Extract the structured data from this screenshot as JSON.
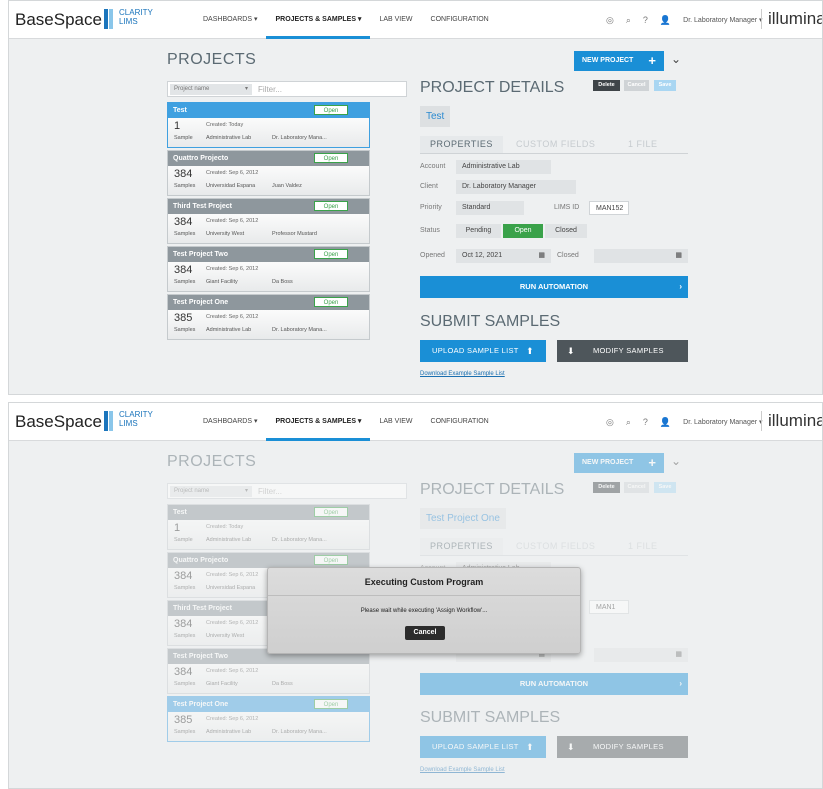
{
  "app": {
    "brand": "BaseSpace",
    "sublogo_line1": "CLARITY",
    "sublogo_line2": "LIMS",
    "vendor": "illumina",
    "accent": "#1a8fd6"
  },
  "nav": {
    "items": [
      "DASHBOARDS ▾",
      "PROJECTS & SAMPLES ▾",
      "LAB VIEW",
      "CONFIGURATION"
    ],
    "active_index": 1,
    "icons": [
      "help-circle-icon",
      "search-icon",
      "question-icon",
      "user-icon"
    ],
    "user": "Dr. Laboratory Manager ▾"
  },
  "projects": {
    "title": "PROJECTS",
    "filter_select": "Project name",
    "filter_placeholder": "Filter..."
  },
  "details": {
    "title": "PROJECT DETAILS",
    "new_project": "NEW PROJECT",
    "delete": "Delete",
    "cancel": "Cancel",
    "save": "Save",
    "tabs": [
      "PROPERTIES",
      "CUSTOM FIELDS",
      "1 FILE"
    ],
    "labels": {
      "account": "Account",
      "client": "Client",
      "priority": "Priority",
      "lims_id": "LIMS ID",
      "status": "Status",
      "opened": "Opened",
      "closed": "Closed"
    },
    "status_options": [
      "Pending",
      "Open",
      "Closed"
    ],
    "run_automation": "RUN AUTOMATION",
    "submit_title": "SUBMIT SAMPLES",
    "upload": "UPLOAD SAMPLE LIST",
    "modify": "MODIFY SAMPLES",
    "download_link": "Download Example Sample List"
  },
  "screen1": {
    "project_name": "Test",
    "account": "Administrative Lab",
    "client": "Dr. Laboratory Manager",
    "priority": "Standard",
    "lims_id": "MAN152",
    "opened": "Oct 12, 2021",
    "closed": "",
    "projects": [
      {
        "name": "Test",
        "badge": "Open",
        "count": "1",
        "unit": "Sample",
        "created": "Created: Today",
        "place": "Administrative Lab",
        "owner": "Dr. Laboratory Mana..."
      },
      {
        "name": "Quattro Projecto",
        "badge": "Open",
        "count": "384",
        "unit": "Samples",
        "created": "Created: Sep 6, 2012",
        "place": "Universidad Espana",
        "owner": "Juan Valdez"
      },
      {
        "name": "Third Test Project",
        "badge": "Open",
        "count": "384",
        "unit": "Samples",
        "created": "Created: Sep 6, 2012",
        "place": "University West",
        "owner": "Professor Mustard"
      },
      {
        "name": "Test Project Two",
        "badge": "Open",
        "count": "384",
        "unit": "Samples",
        "created": "Created: Sep 6, 2012",
        "place": "Giant Facility",
        "owner": "Da Boss"
      },
      {
        "name": "Test Project One",
        "badge": "Open",
        "count": "385",
        "unit": "Samples",
        "created": "Created: Sep 6, 2012",
        "place": "Administrative Lab",
        "owner": "Dr. Laboratory Mana..."
      }
    ]
  },
  "screen2": {
    "project_name": "Test Project One",
    "account": "Administrative Lab",
    "lims_id": "MAN1",
    "modal": {
      "title": "Executing Custom Program",
      "message": "Please wait while executing 'Assign Workflow'...",
      "cancel": "Cancel"
    }
  }
}
